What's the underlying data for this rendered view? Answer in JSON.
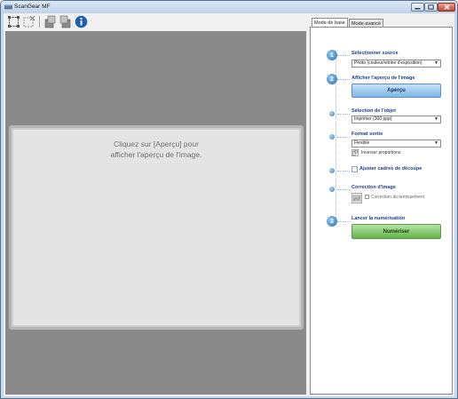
{
  "window": {
    "title": "ScanGear MF"
  },
  "toolbar": {
    "icons": [
      "crop-icon",
      "clear-crop-icon",
      "rotate-left-icon",
      "rotate-right-icon",
      "info-icon"
    ]
  },
  "preview": {
    "message": "Cliquez sur [Aperçu] pour\nafficher l'aperçu de l'image."
  },
  "tabs": [
    {
      "label": "Mode de base",
      "active": true
    },
    {
      "label": "Mode avancé",
      "active": false
    }
  ],
  "steps": {
    "source": {
      "number": "1",
      "label": "Sélectionner source",
      "value": "Photo (couleur/vitrine d'exposition)"
    },
    "preview": {
      "number": "2",
      "label": "Afficher l'aperçu de l'image",
      "button": "Aperçu"
    },
    "object": {
      "label": "Sélection de l'objet",
      "value": "Imprimer (300 ppp)"
    },
    "output": {
      "label": "Format sortie",
      "value": "Flexible",
      "invert_label": "Inverser proportions"
    },
    "crop": {
      "label": "Ajuster cadres de découpe"
    },
    "correction": {
      "label": "Correction d'image",
      "fade_label": "Correction du ternissement",
      "fade_checked": false
    },
    "scan": {
      "number": "3",
      "label": "Lancer la numérisation",
      "button": "Numériser"
    }
  },
  "colors": {
    "accent_blue": "#2a6fb3",
    "label_blue": "#1b3f8f",
    "scan_green": "#62b548",
    "preview_bg": "#8a8a8a"
  }
}
